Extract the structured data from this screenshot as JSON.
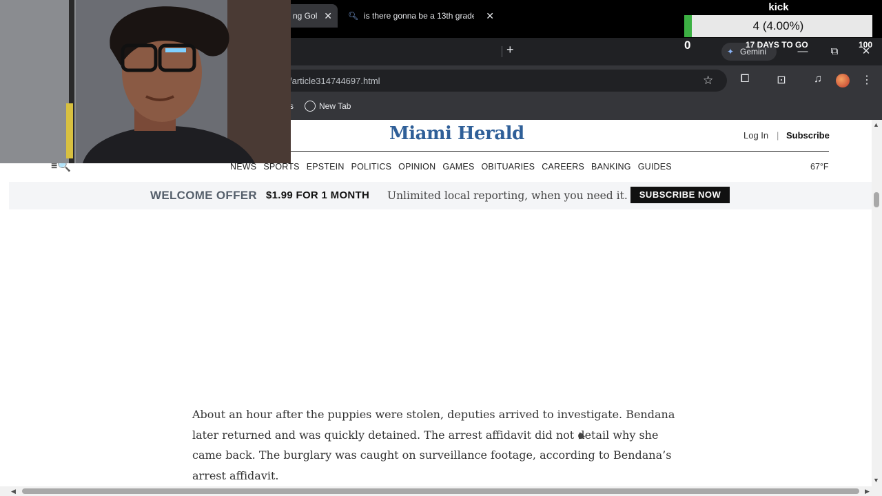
{
  "browser": {
    "tabs": [
      {
        "title": "ng Gol"
      },
      {
        "title": "is there gonna be a 13th grade"
      }
    ],
    "new_tab_symbol": "+",
    "tab_close_symbol": "✕",
    "gemini_label": "Gemini",
    "window_controls": {
      "minimize": "—",
      "restore": "⧉",
      "close": "✕"
    },
    "url": "/article314744697.html",
    "bookmarks": [
      {
        "label": "s"
      },
      {
        "label": "New Tab"
      }
    ]
  },
  "site": {
    "logo": "Miami Herald",
    "login": "Log In",
    "separator": "|",
    "subscribe": "Subscribe",
    "nav": [
      "NEWS",
      "SPORTS",
      "EPSTEIN",
      "POLITICS",
      "OPINION",
      "GAMES",
      "OBITUARIES",
      "CAREERS",
      "BANKING",
      "GUIDES"
    ],
    "weather": "67°F",
    "menu_icon": "≡🔍"
  },
  "offer": {
    "title": "WELCOME OFFER",
    "price": "$1.99 FOR 1 MONTH",
    "desc": "Unlimited local reporting, when you need it.",
    "button": "SUBSCRIBE NOW"
  },
  "article": {
    "paragraph": "About an hour after the puppies were stolen, deputies arrived to investigate. Bendana later returned and was quickly detained. The arrest affidavit did not detail why she came back. The burglary was caught on surveillance footage, according to Bendana’s arrest affidavit."
  },
  "overlay": {
    "platform": "kick",
    "goal_text": "4 (4.00%)",
    "goal_fraction": 0.04,
    "goal_start": "0",
    "goal_days": "17 DAYS TO GO",
    "goal_end": "100"
  }
}
